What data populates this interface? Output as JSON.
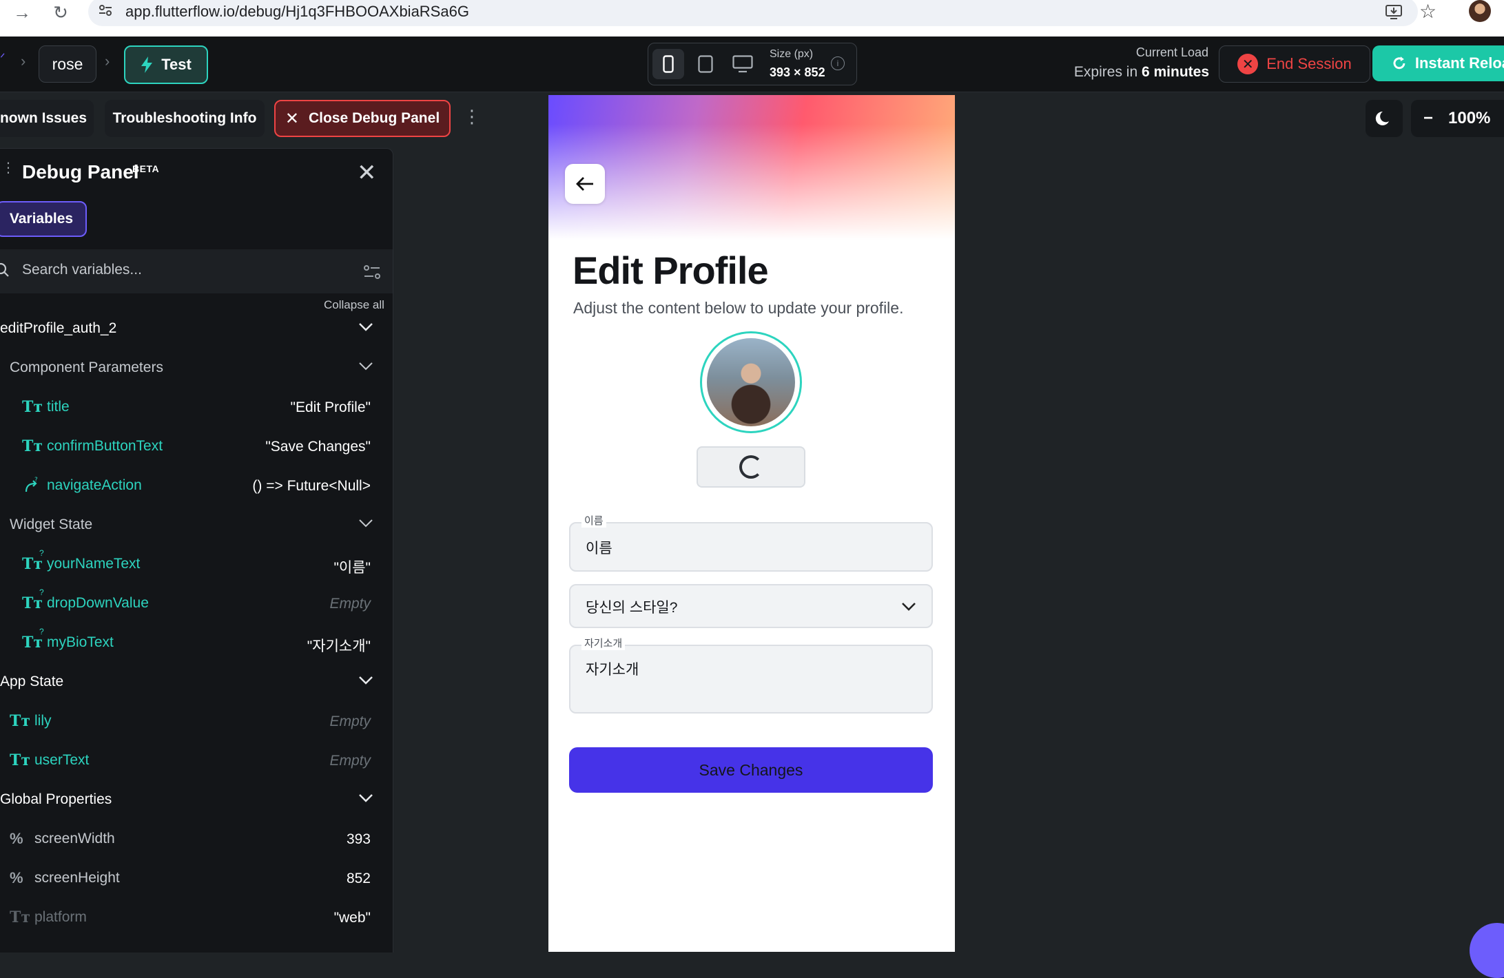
{
  "browser": {
    "url": "app.flutterflow.io/debug/Hj1q3FHBOOAXbiaRSa6G"
  },
  "topbar": {
    "project_name": "rose",
    "test_label": "Test",
    "size_label": "Size (px)",
    "size_value": "393 × 852",
    "load_title": "Current Load",
    "expires_prefix": "Expires in",
    "expires_value": "6 minutes",
    "end_session_label": "End Session",
    "instant_reload_label": "Instant Reloa"
  },
  "toolbar": {
    "known_issues_label": "nown Issues",
    "troubleshooting_label": "Troubleshooting Info",
    "close_debug_label": "Close Debug Panel",
    "zoom_value": "100%"
  },
  "debug_panel": {
    "title": "Debug Panel",
    "badge": "BETA",
    "tab_label": "Variables",
    "search_placeholder": "Search variables...",
    "collapse_all_label": "Collapse all",
    "component_name": "editProfile_auth_2",
    "sections": {
      "component_parameters": "Component Parameters",
      "widget_state": "Widget State",
      "app_state": "App State",
      "global_properties": "Global Properties"
    },
    "component_parameters": [
      {
        "name": "title",
        "value": "\"Edit Profile\""
      },
      {
        "name": "confirmButtonText",
        "value": "\"Save Changes\""
      },
      {
        "name": "navigateAction",
        "value": "() => Future<Null>"
      }
    ],
    "widget_state": [
      {
        "name": "yourNameText",
        "value": "\"이름\""
      },
      {
        "name": "dropDownValue",
        "value": "Empty"
      },
      {
        "name": "myBioText",
        "value": "\"자기소개\""
      }
    ],
    "app_state": [
      {
        "name": "lily",
        "value": "Empty"
      },
      {
        "name": "userText",
        "value": "Empty"
      }
    ],
    "global_properties": [
      {
        "name": "screenWidth",
        "value": "393"
      },
      {
        "name": "screenHeight",
        "value": "852"
      },
      {
        "name": "platform",
        "value": "\"web\""
      }
    ]
  },
  "phone": {
    "title": "Edit Profile",
    "subtitle": "Adjust the content below to update your profile.",
    "name_label": "이름",
    "name_value": "이름",
    "dropdown_value": "당신의 스타일?",
    "bio_label": "자기소개",
    "bio_value": "자기소개",
    "save_label": "Save Changes"
  },
  "colors": {
    "accent_teal": "#2dd4bf",
    "danger_red": "#ef4444",
    "primary_purple": "#4633e8",
    "panel_bg": "#131518"
  }
}
